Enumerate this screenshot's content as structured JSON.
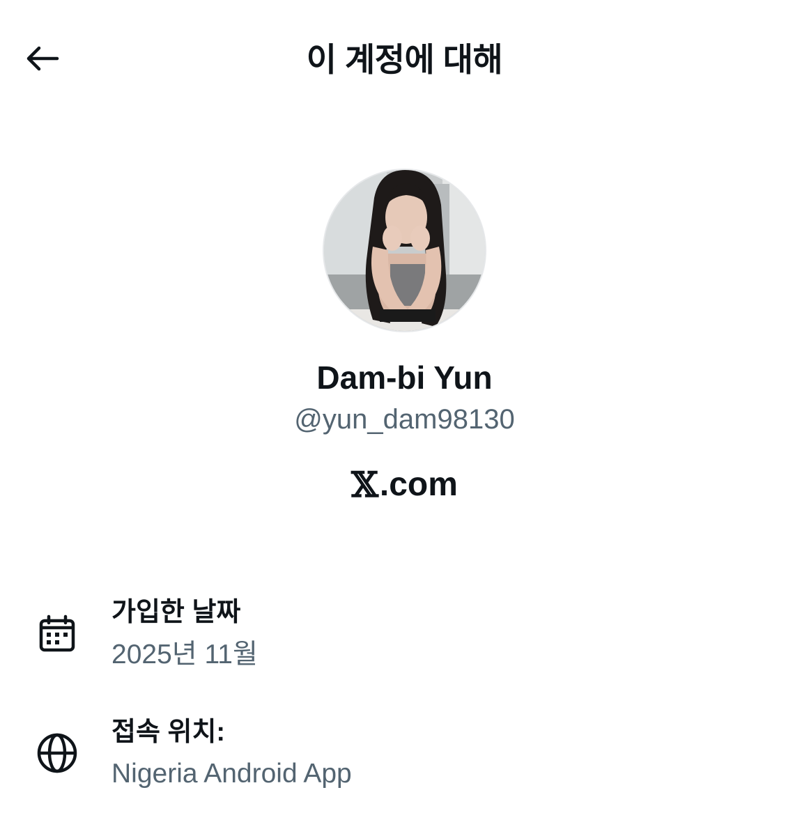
{
  "header": {
    "title": "이 계정에 대해",
    "back_icon": "arrow-left-icon"
  },
  "profile": {
    "display_name": "Dam-bi Yun",
    "handle": "@yun_dam98130",
    "platform_logo": "𝕏",
    "platform_suffix": ".com"
  },
  "details": [
    {
      "icon": "calendar-icon",
      "label": "가입한 날짜",
      "value": "2025년 11월"
    },
    {
      "icon": "globe-icon",
      "label": "접속 위치:",
      "value": "Nigeria Android App"
    }
  ],
  "colors": {
    "text_primary": "#0f1419",
    "text_secondary": "#536471",
    "background": "#ffffff"
  }
}
